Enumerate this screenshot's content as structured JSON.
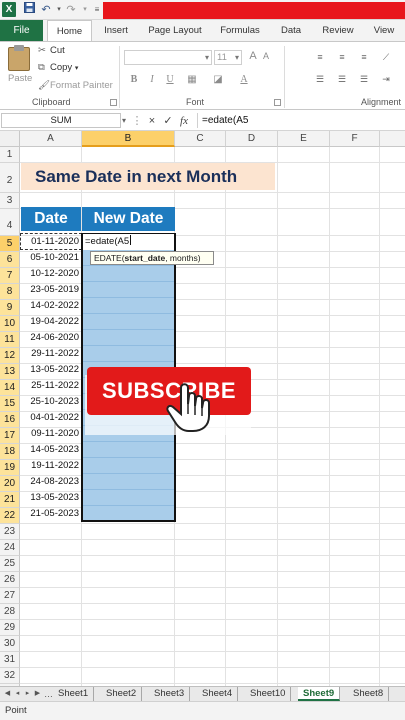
{
  "quick_access": {
    "app_icon": "X",
    "save_icon": "save-icon",
    "undo_icon": "undo-icon",
    "redo_icon": "redo-icon"
  },
  "ribbon_tabs": [
    "File",
    "Home",
    "Insert",
    "Page Layout",
    "Formulas",
    "Data",
    "Review",
    "View"
  ],
  "clipboard": {
    "paste": "Paste",
    "cut": "Cut",
    "copy": "Copy",
    "format_painter": "Format Painter",
    "group_label": "Clipboard"
  },
  "font": {
    "group_label": "Font",
    "size": "11",
    "bold": "B",
    "italic": "I",
    "underline": "U"
  },
  "alignment": {
    "group_label": "Alignment"
  },
  "formula_bar": {
    "name_box": "SUM",
    "cancel_icon": "×",
    "enter_icon": "✓",
    "fx": "fx",
    "formula": "=edate(A5"
  },
  "columns": [
    "A",
    "B",
    "C",
    "D",
    "E",
    "F"
  ],
  "rows": [
    "1",
    "2",
    "3",
    "4",
    "5",
    "6",
    "7",
    "8",
    "9",
    "10",
    "11",
    "12",
    "13",
    "14",
    "15",
    "16",
    "17",
    "18",
    "19",
    "20",
    "21",
    "22",
    "23",
    "24",
    "25",
    "26",
    "27",
    "28",
    "29",
    "30",
    "31",
    "32",
    "33"
  ],
  "sheet": {
    "title": "Same Date in next Month",
    "header_date": "Date",
    "header_new_date": "New Date",
    "active_cell_text": "=edate(A5",
    "tooltip_fn": "EDATE(",
    "tooltip_bold": "start_date",
    "tooltip_rest": ", months)",
    "dates": [
      "01-11-2020",
      "05-10-2021",
      "10-12-2020",
      "23-05-2019",
      "14-02-2022",
      "19-04-2022",
      "24-06-2020",
      "29-11-2022",
      "13-05-2022",
      "25-11-2022",
      "25-10-2023",
      "04-01-2022",
      "09-11-2020",
      "14-05-2023",
      "19-11-2022",
      "24-08-2023",
      "13-05-2023",
      "21-05-2023"
    ]
  },
  "overlay": {
    "subscribe": "SUBSCRIBE"
  },
  "sheet_tabs": [
    "Sheet1",
    "Sheet2",
    "Sheet3",
    "Sheet4",
    "Sheet10",
    "Sheet9",
    "Sheet8"
  ],
  "active_sheet": "Sheet9",
  "status": "Point",
  "colors": {
    "excel_green": "#1f7244",
    "header_blue": "#1e7bbf",
    "title_fill": "#fce4d0",
    "selection_fill": "#a9cdea",
    "subscribe_red": "#e21a1a"
  }
}
